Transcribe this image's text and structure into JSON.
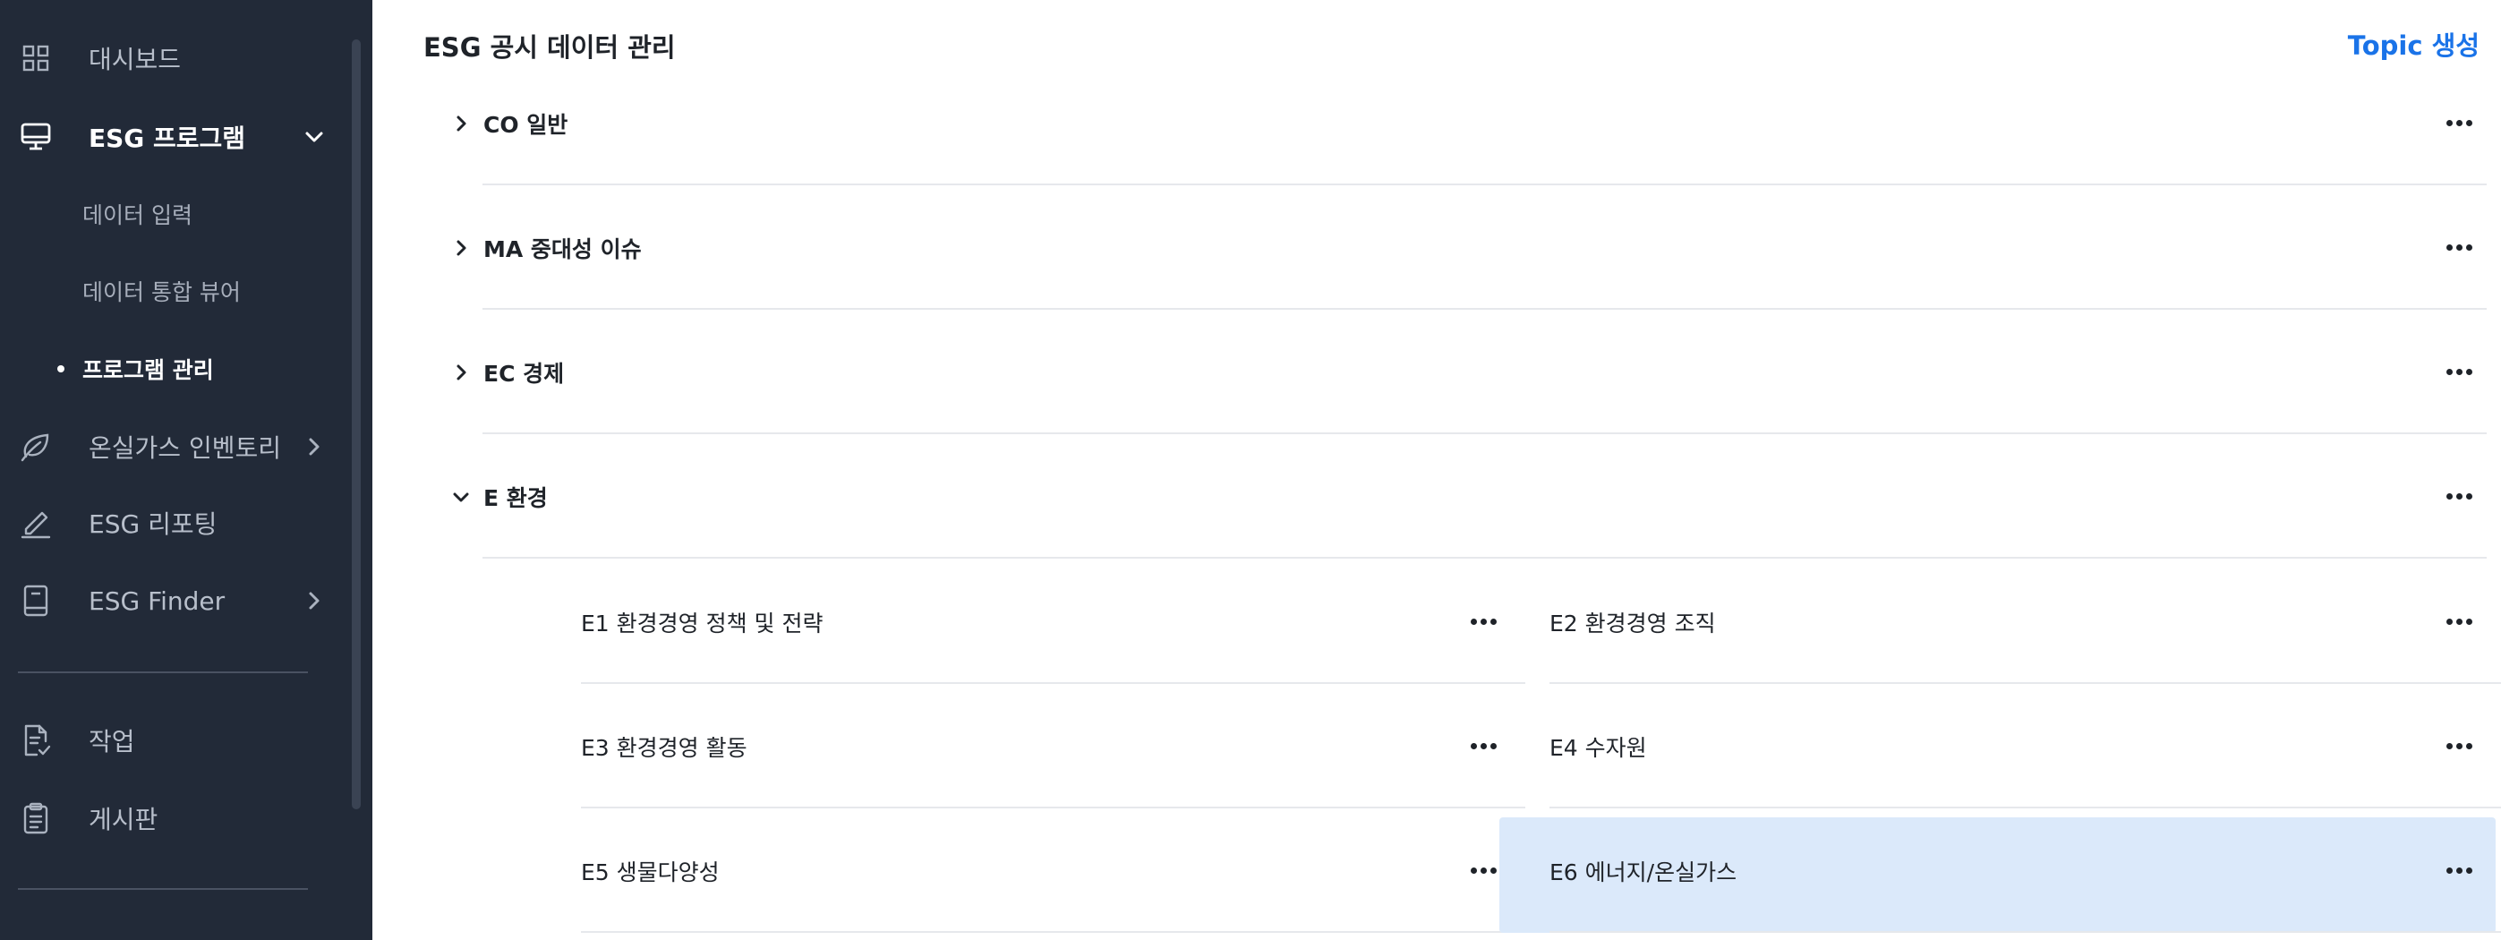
{
  "sidebar": {
    "items": [
      {
        "label": "대시보드",
        "icon": "grid-icon"
      },
      {
        "label": "ESG 프로그램",
        "icon": "monitor-icon"
      },
      {
        "label": "온실가스 인벤토리",
        "icon": "leaf-icon"
      },
      {
        "label": "ESG 리포팅",
        "icon": "edit-icon"
      },
      {
        "label": "ESG Finder",
        "icon": "book-icon"
      },
      {
        "label": "작업",
        "icon": "document-check-icon"
      },
      {
        "label": "게시판",
        "icon": "clipboard-icon"
      }
    ],
    "sub_items": [
      {
        "label": "데이터 입력"
      },
      {
        "label": "데이터 통합 뷰어"
      },
      {
        "label": "프로그램 관리"
      }
    ]
  },
  "main": {
    "title": "ESG 공시 데이터 관리",
    "create_topic_label": "Topic 생성",
    "topics": [
      {
        "label": "CO 일반",
        "expanded": false
      },
      {
        "label": "MA 중대성 이슈",
        "expanded": false
      },
      {
        "label": "EC 경제",
        "expanded": false
      },
      {
        "label": "E 환경",
        "expanded": true
      }
    ],
    "subtopics": [
      {
        "label": "E1 환경경영 정책 및 전략"
      },
      {
        "label": "E2 환경경영 조직"
      },
      {
        "label": "E3 환경경영 활동"
      },
      {
        "label": "E4 수자원"
      },
      {
        "label": "E5 생물다양성"
      },
      {
        "label": "E6 에너지/온실가스",
        "selected": true
      }
    ]
  },
  "colors": {
    "sidebar_bg": "#222a38",
    "accent": "#1a73e8",
    "selected_bg": "#dbe9fa"
  }
}
